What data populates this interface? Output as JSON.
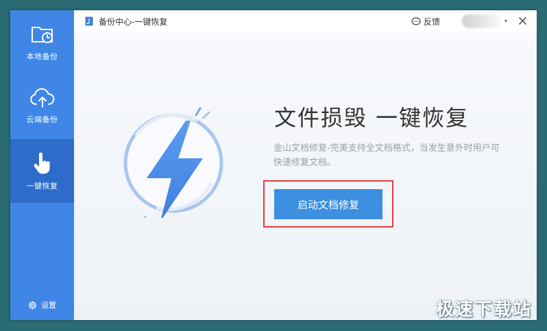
{
  "sidebar": {
    "items": [
      {
        "label": "本地备份",
        "icon": "folder-clock-icon",
        "active": false
      },
      {
        "label": "云端备份",
        "icon": "cloud-upload-icon",
        "active": false
      },
      {
        "label": "一键恢复",
        "icon": "hand-pointer-icon",
        "active": true
      }
    ],
    "settings_label": "设置",
    "color": "#3f86e6",
    "active_color": "#2d6cc8"
  },
  "titlebar": {
    "title": "备份中心-一键恢复",
    "feedback_label": "反馈",
    "dropdown_glyph": "▾",
    "close_glyph": "✕"
  },
  "main": {
    "headline": "文件损毁  一键恢复",
    "description": "金山文档修复-完美支持全文档格式，当发生意外时用户可快速修复文档。",
    "button_label": "启动文档修复",
    "button_color": "#3d8fe0",
    "highlight_color": "#e43c3c"
  },
  "watermark": "极速下载站"
}
